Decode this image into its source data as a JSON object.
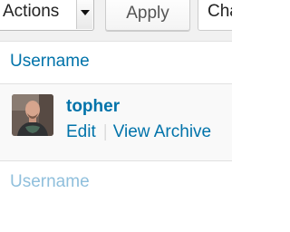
{
  "toolbar": {
    "bulk_actions_selected": "Actions",
    "apply_label": "Apply",
    "change_role_selected": "Cha"
  },
  "table": {
    "header_column": "Username",
    "footer_column": "Username",
    "rows": [
      {
        "username": "topher",
        "actions": [
          "Edit",
          "View Archive"
        ]
      }
    ]
  },
  "colors": {
    "link": "#0073aa",
    "footer_link": "#8fbfdc",
    "background": "#f1f1f1",
    "row_background": "#f9f9f9"
  },
  "icons": {
    "dropdown": "chevron-down-icon",
    "avatar": "user-avatar"
  }
}
